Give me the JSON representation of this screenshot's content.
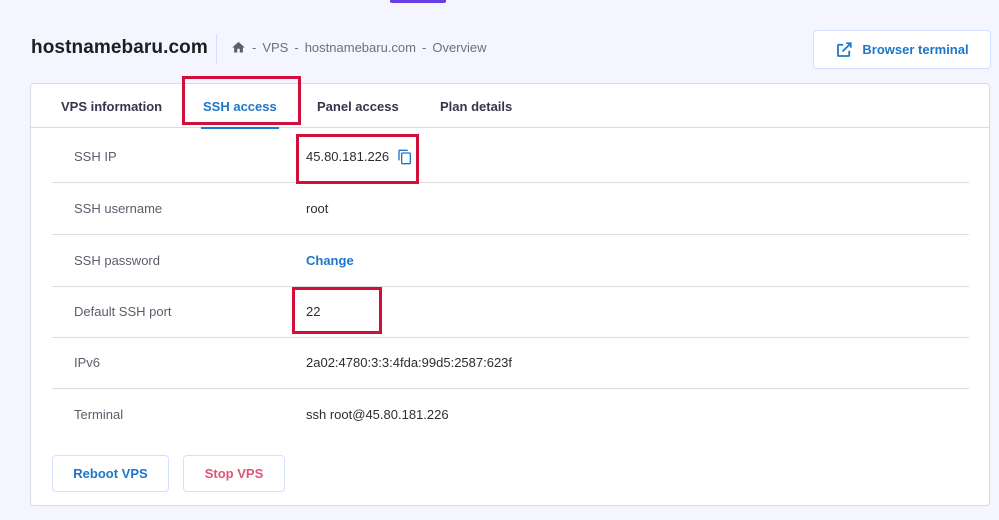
{
  "header": {
    "host_title": "hostnamebaru.com",
    "breadcrumb": [
      "VPS",
      "-",
      "hostnamebaru.com",
      "-",
      "Overview"
    ],
    "browser_terminal_label": "Browser terminal"
  },
  "tabs": [
    {
      "label": "VPS information",
      "active": false
    },
    {
      "label": "SSH access",
      "active": true
    },
    {
      "label": "Panel access",
      "active": false
    },
    {
      "label": "Plan details",
      "active": false
    }
  ],
  "rows": [
    {
      "label": "SSH IP",
      "value": "45.80.181.226",
      "copyable": true
    },
    {
      "label": "SSH username",
      "value": "root"
    },
    {
      "label": "SSH password",
      "value": "Change",
      "link": true
    },
    {
      "label": "Default SSH port",
      "value": "22"
    },
    {
      "label": "IPv6",
      "value": "2a02:4780:3:3:4fda:99d5:2587:623f"
    },
    {
      "label": "Terminal",
      "value": "ssh root@45.80.181.226"
    }
  ],
  "actions": {
    "reboot_label": "Reboot VPS",
    "stop_label": "Stop VPS"
  },
  "colors": {
    "accent": "#1e76c9",
    "danger": "#e05477",
    "highlight": "#d0103a",
    "background": "#f4f5ff"
  },
  "icons": {
    "home": "home-icon",
    "external": "external-link-icon",
    "copy": "copy-icon"
  }
}
